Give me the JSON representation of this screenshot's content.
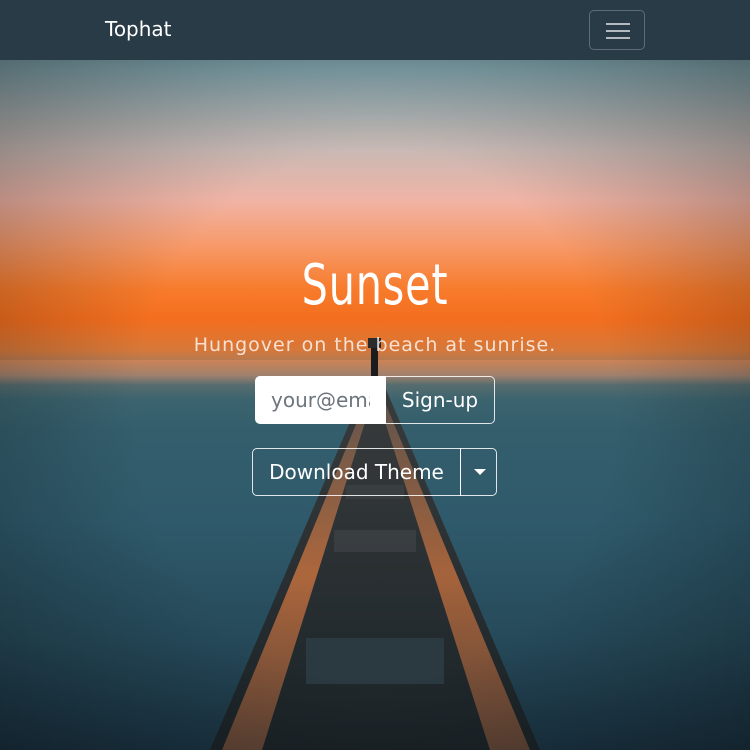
{
  "navbar": {
    "brand": "Tophat",
    "toggler_icon": "hamburger-icon"
  },
  "hero": {
    "title": "Sunset",
    "subtitle": "Hungover on the beach at sunrise.",
    "email_placeholder": "your@email",
    "signup_label": "Sign-up",
    "download_label": "Download Theme",
    "caret_icon": "caret-down-icon"
  },
  "colors": {
    "navbar": "#2a3b48",
    "text": "#ffffff",
    "sky_orange": "#f77b2b",
    "sea": "#2f5a6b"
  }
}
